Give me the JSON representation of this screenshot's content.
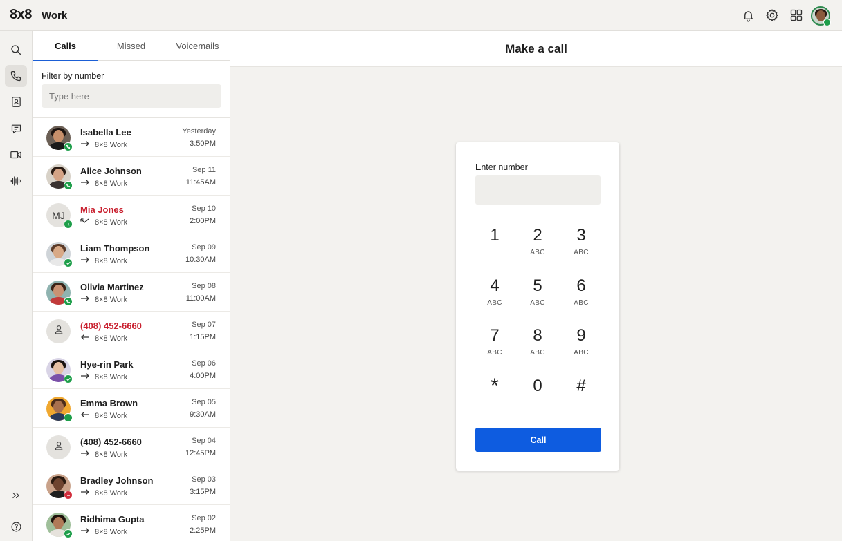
{
  "topbar": {
    "logo": "8x8",
    "app_name": "Work",
    "icons": [
      "bell-icon",
      "gear-icon",
      "apps-grid-icon"
    ],
    "status_color": "#1e9e4a"
  },
  "rail": {
    "items": [
      "search-icon",
      "phone-icon",
      "contacts-icon",
      "chat-icon",
      "video-icon",
      "voicemail-waveform-icon"
    ],
    "active": "phone-icon",
    "bottom": [
      "expand-icon",
      "help-icon"
    ]
  },
  "panel": {
    "tabs": [
      "Calls",
      "Missed",
      "Voicemails"
    ],
    "active_tab": "Calls",
    "filter_label": "Filter by number",
    "filter_placeholder": "Type here",
    "calls": [
      {
        "name": "Isabella Lee",
        "line": "8×8 Work",
        "date": "Yesterday",
        "time": "3:50PM",
        "direction": "outgoing",
        "missed": false
      },
      {
        "name": "Alice Johnson",
        "line": "8×8 Work",
        "date": "Sep 11",
        "time": "11:45AM",
        "direction": "outgoing",
        "missed": false
      },
      {
        "name": "Mia Jones",
        "initials": "MJ",
        "line": "8×8 Work",
        "date": "Sep 10",
        "time": "2:00PM",
        "direction": "missed",
        "missed": true
      },
      {
        "name": "Liam Thompson",
        "line": "8×8 Work",
        "date": "Sep 09",
        "time": "10:30AM",
        "direction": "outgoing",
        "missed": false
      },
      {
        "name": "Olivia Martinez",
        "line": "8×8 Work",
        "date": "Sep 08",
        "time": "11:00AM",
        "direction": "outgoing",
        "missed": false
      },
      {
        "name": "(408) 452-6660",
        "line": "8×8 Work",
        "date": "Sep 07",
        "time": "1:15PM",
        "direction": "incoming",
        "missed": true
      },
      {
        "name": "Hye-rin Park",
        "line": "8×8 Work",
        "date": "Sep 06",
        "time": "4:00PM",
        "direction": "outgoing",
        "missed": false
      },
      {
        "name": "Emma Brown",
        "line": "8×8 Work",
        "date": "Sep 05",
        "time": "9:30AM",
        "direction": "incoming",
        "missed": false
      },
      {
        "name": "(408) 452-6660",
        "line": "8×8 Work",
        "date": "Sep 04",
        "time": "12:45PM",
        "direction": "outgoing",
        "missed": false
      },
      {
        "name": "Bradley Johnson",
        "line": "8×8 Work",
        "date": "Sep 03",
        "time": "3:15PM",
        "direction": "outgoing",
        "missed": false
      },
      {
        "name": "Ridhima Gupta",
        "line": "8×8 Work",
        "date": "Sep 02",
        "time": "2:25PM",
        "direction": "outgoing",
        "missed": false
      }
    ]
  },
  "main": {
    "title": "Make a call",
    "enter_label": "Enter number",
    "keys": [
      {
        "digit": "1",
        "letters": ""
      },
      {
        "digit": "2",
        "letters": "ABC"
      },
      {
        "digit": "3",
        "letters": "ABC"
      },
      {
        "digit": "4",
        "letters": "ABC"
      },
      {
        "digit": "5",
        "letters": "ABC"
      },
      {
        "digit": "6",
        "letters": "ABC"
      },
      {
        "digit": "7",
        "letters": "ABC"
      },
      {
        "digit": "8",
        "letters": "ABC"
      },
      {
        "digit": "9",
        "letters": "ABC"
      },
      {
        "digit": "*",
        "letters": ""
      },
      {
        "digit": "0",
        "letters": ""
      },
      {
        "digit": "#",
        "letters": ""
      }
    ],
    "call_label": "Call",
    "accent": "#0e5ce0"
  }
}
